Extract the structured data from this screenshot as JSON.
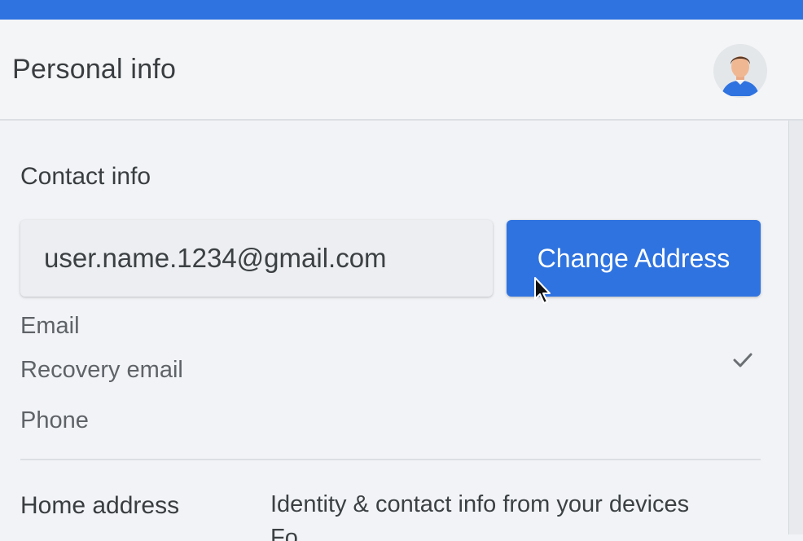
{
  "header": {
    "title": "Personal info",
    "avatar_icon": "user-avatar-icon"
  },
  "contact": {
    "title": "Contact info",
    "email_value": "user.name.1234@gmail.com",
    "change_button_label": "Change Address",
    "items": [
      {
        "label": "Email"
      },
      {
        "label": "Recovery email",
        "checked": true
      },
      {
        "label": "Phone"
      }
    ]
  },
  "home": {
    "label": "Home address",
    "description": "Identity & contact info from your devices",
    "description_2": "Fo..."
  },
  "colors": {
    "accent": "#2f73e0",
    "background": "#f1f3f6"
  }
}
